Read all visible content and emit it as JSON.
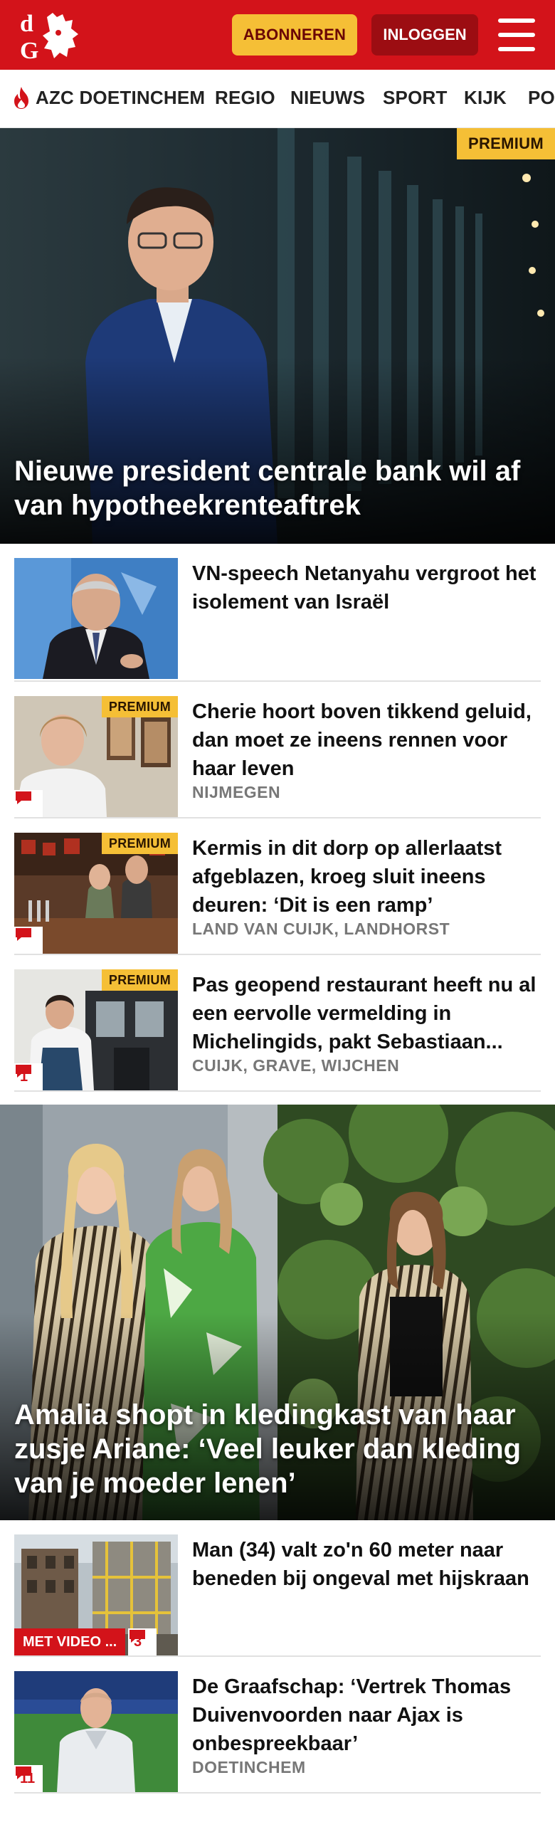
{
  "header": {
    "logo_text": "dG",
    "subscribe_label": "ABONNEREN",
    "login_label": "INLOGGEN"
  },
  "nav": {
    "items": [
      {
        "label": "AZC DOETINCHEM",
        "icon": "flame-icon"
      },
      {
        "label": "REGIO"
      },
      {
        "label": "NIEUWS"
      },
      {
        "label": "SPORT"
      },
      {
        "label": "KIJK"
      },
      {
        "label": "PO"
      }
    ]
  },
  "hero1": {
    "title": "Nieuwe president centrale bank wil af van hypotheekrenteaftrek",
    "premium_label": "PREMIUM"
  },
  "articles1": [
    {
      "title": "VN-speech Netanyahu vergroot het isolement van Israël",
      "meta": "",
      "premium": false,
      "comments": ""
    },
    {
      "title": "Cherie hoort boven tikkend geluid, dan moet ze ineens rennen voor haar leven",
      "meta": "NIJMEGEN",
      "premium_label": "PREMIUM",
      "comments": ""
    },
    {
      "title": "Kermis in dit dorp op allerlaatst afgeblazen, kroeg sluit ineens deuren: ‘Dit is een ramp’",
      "meta": "LAND VAN CUIJK, LANDHORST",
      "premium_label": "PREMIUM",
      "comments": ""
    },
    {
      "title": "Pas geopend restaurant heeft nu al een eervolle vermelding in Michelingids, pakt Sebastiaan...",
      "meta": "CUIJK, GRAVE, WIJCHEN",
      "premium_label": "PREMIUM",
      "comments": "1"
    }
  ],
  "hero2": {
    "title": "Amalia shopt in kledingkast van haar zusje Ariane: ‘Veel leuker dan kleding van je moeder lenen’"
  },
  "articles2": [
    {
      "title": "Man (34) valt zo'n 60 meter naar beneden bij ongeval met hijskraan",
      "meta": "",
      "video_label": "MET VIDEO ...",
      "comments": "3"
    },
    {
      "title": "De Graafschap: ‘Vertrek Thomas Duivenvoorden naar Ajax is onbespreekbaar’",
      "meta": "DOETINCHEM",
      "comments": "11"
    }
  ],
  "colors": {
    "brand_red": "#d3131a",
    "subscribe_yellow": "#f5bf36",
    "login_dark_red": "#9c0d12",
    "meta_gray": "#777777"
  }
}
